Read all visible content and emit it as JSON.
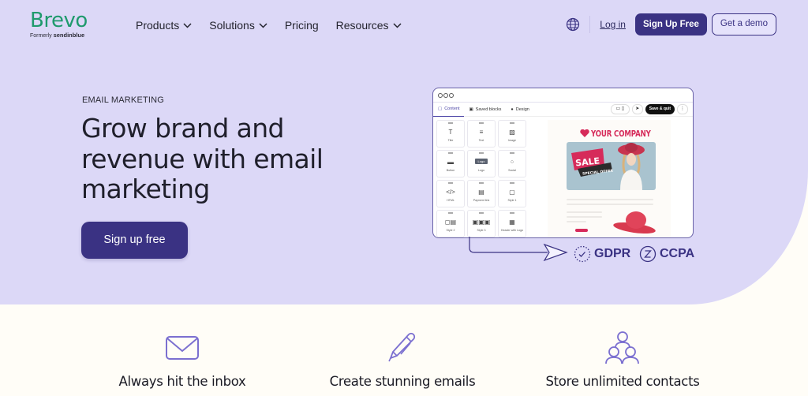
{
  "nav": {
    "logo": "Brevo",
    "logo_sub_prefix": "Formerly",
    "logo_sub_brand": "sendinblue",
    "menu": [
      {
        "label": "Products",
        "has_dropdown": true
      },
      {
        "label": "Solutions",
        "has_dropdown": true
      },
      {
        "label": "Pricing",
        "has_dropdown": false
      },
      {
        "label": "Resources",
        "has_dropdown": true
      }
    ],
    "login": "Log in",
    "signup": "Sign Up Free",
    "demo": "Get a demo"
  },
  "hero": {
    "eyebrow": "EMAIL MARKETING",
    "headline": "Grow brand and revenue with email marketing",
    "cta": "Sign up free"
  },
  "editor": {
    "tabs": [
      "Content",
      "Saved blocks",
      "Design"
    ],
    "save_quit": "Save & quit",
    "blocks": [
      "Title",
      "Text",
      "Image",
      "Button",
      "Logo",
      "Social",
      "HTML",
      "Payment link",
      "Style 1",
      "Style 2",
      "Style 3",
      "Header with Logo"
    ],
    "preview_company": "YOUR COMPANY",
    "sale": "SALE",
    "special_offer": "SPECIAL OFFER"
  },
  "compliance": [
    "GDPR",
    "CCPA"
  ],
  "features": [
    {
      "title": "Always hit the inbox",
      "icon": "envelope-icon"
    },
    {
      "title": "Create stunning emails",
      "icon": "pencil-icon"
    },
    {
      "title": "Store unlimited contacts",
      "icon": "contacts-icon"
    }
  ],
  "colors": {
    "hero_bg": "#dcd8f7",
    "primary": "#3a3283",
    "brand_green": "#1f9a6d",
    "accent_pink": "#d62b5a",
    "icon_purple": "#7b6fd0"
  }
}
